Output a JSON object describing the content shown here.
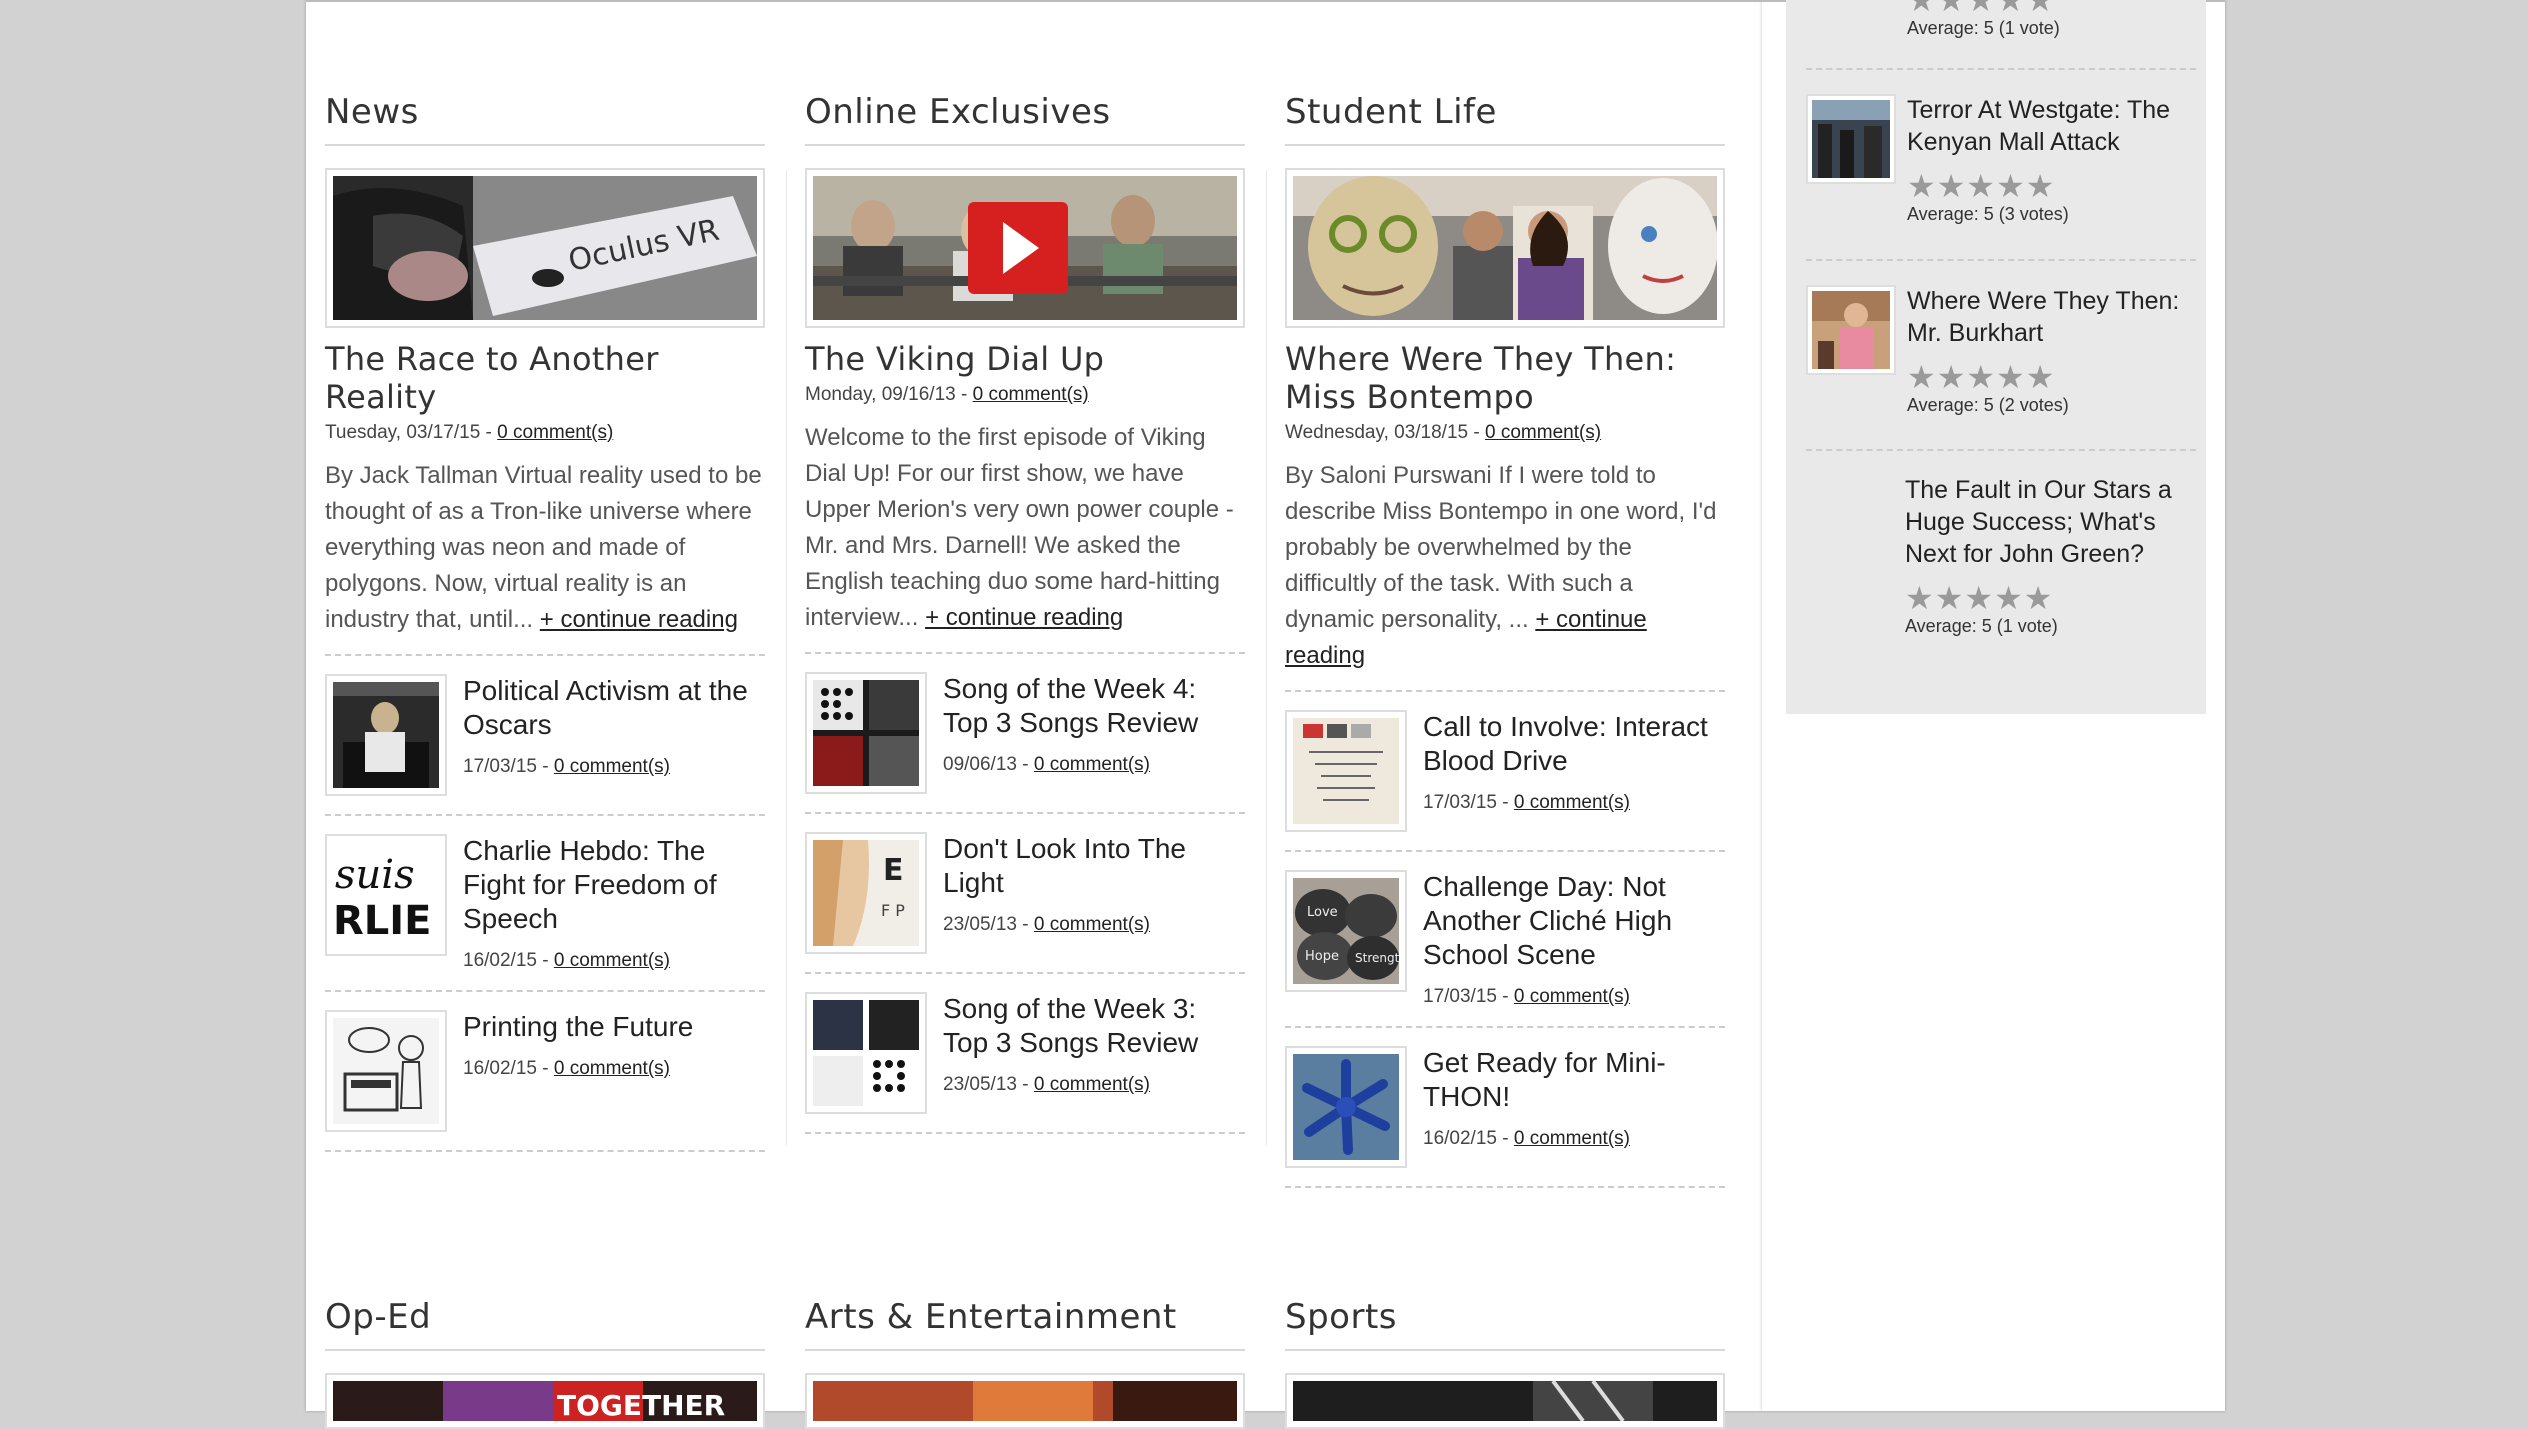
{
  "sections": {
    "news": {
      "title": "News",
      "featured": {
        "title": "The Race to Another Reality",
        "date": "Tuesday, 03/17/15",
        "comments": "0 comment(s)",
        "excerpt": "By Jack Tallman    Virtual reality used to be thought of as a Tron-like universe where everything was neon and made of polygons. Now, virtual reality is an industry that, until...",
        "more": "+ continue reading",
        "image_text": "Oculus VR"
      },
      "items": [
        {
          "title": "Political Activism at the Oscars",
          "date": "17/03/15",
          "comments": "0 comment(s)"
        },
        {
          "title": "Charlie Hebdo: The Fight for Freedom of Speech",
          "date": "16/02/15",
          "comments": "0 comment(s)",
          "image_text": "suis RLIE"
        },
        {
          "title": "Printing the Future",
          "date": "16/02/15",
          "comments": "0 comment(s)"
        }
      ]
    },
    "online": {
      "title": "Online Exclusives",
      "featured": {
        "title": "The Viking Dial Up",
        "date": "Monday, 09/16/13",
        "comments": "0 comment(s)",
        "excerpt": "Welcome to the first episode of Viking Dial Up! For our first show, we have Upper Merion's very own power couple - Mr. and Mrs. Darnell! We asked the English teaching duo some hard-hitting interview...",
        "more": "+ continue reading"
      },
      "items": [
        {
          "title": "Song of the Week 4: Top 3 Songs Review",
          "date": "09/06/13",
          "comments": "0 comment(s)"
        },
        {
          "title": "Don't Look Into The Light",
          "date": "23/05/13",
          "comments": "0 comment(s)"
        },
        {
          "title": "Song of the Week 3: Top 3 Songs Review",
          "date": "23/05/13",
          "comments": "0 comment(s)"
        }
      ]
    },
    "student": {
      "title": "Student Life",
      "featured": {
        "title": "Where Were They Then: Miss Bontempo",
        "date": "Wednesday, 03/18/15",
        "comments": "0 comment(s)",
        "excerpt": "By Saloni Purswani    If I were told to describe Miss Bontempo in one word, I'd probably be overwhelmed by the difficultly of the task. With such a dynamic personality, ...",
        "more": "+ continue reading"
      },
      "items": [
        {
          "title": "Call to Involve: Interact Blood Drive",
          "date": "17/03/15",
          "comments": "0 comment(s)"
        },
        {
          "title": "Challenge Day: Not Another Cliché High School Scene",
          "date": "17/03/15",
          "comments": "0 comment(s)"
        },
        {
          "title": "Get Ready for Mini-THON!",
          "date": "16/02/15",
          "comments": "0 comment(s)"
        }
      ]
    },
    "oped": {
      "title": "Op-Ed"
    },
    "arts": {
      "title": "Arts & Entertainment"
    },
    "sports": {
      "title": "Sports"
    }
  },
  "sidebar": {
    "top_avg": "Average: 5 (1 vote)",
    "items": [
      {
        "title": "Terror At Westgate: The Kenyan Mall Attack",
        "avg": "Average: 5 (3 votes)",
        "rating": 5
      },
      {
        "title": "Where Were They Then: Mr. Burkhart",
        "avg": "Average: 5 (2 votes)",
        "rating": 5
      },
      {
        "title": "The Fault in Our Stars a Huge Success; What's Next for John Green?",
        "avg": "Average: 5 (1 vote)",
        "rating": 5
      }
    ]
  },
  "icons": {
    "star": "star-icon",
    "play": "play-icon"
  }
}
